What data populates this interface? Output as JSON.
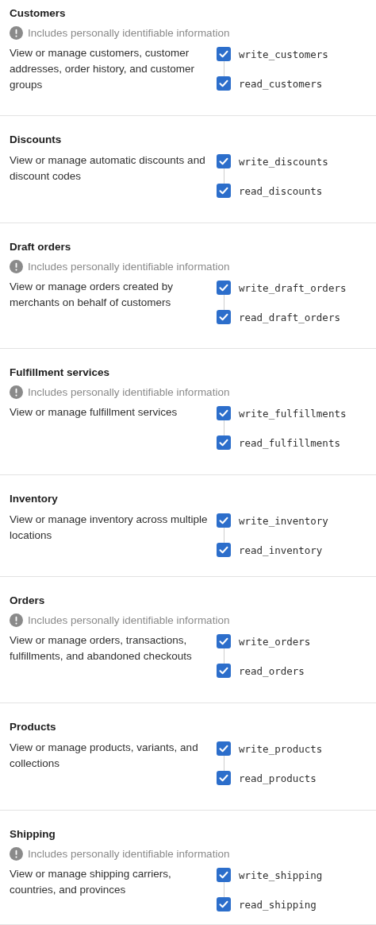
{
  "sections": [
    {
      "title": "Customers",
      "pii_note": "Includes personally identifiable information",
      "description": "View or manage customers, customer addresses, order history, and customer groups",
      "scopes": [
        {
          "label": "write_customers",
          "checked": true
        },
        {
          "label": "read_customers",
          "checked": true
        }
      ]
    },
    {
      "title": "Discounts",
      "description": "View or manage automatic discounts and discount codes",
      "scopes": [
        {
          "label": "write_discounts",
          "checked": true
        },
        {
          "label": "read_discounts",
          "checked": true
        }
      ]
    },
    {
      "title": "Draft orders",
      "pii_note": "Includes personally identifiable information",
      "description": "View or manage orders created by merchants on behalf of customers",
      "scopes": [
        {
          "label": "write_draft_orders",
          "checked": true
        },
        {
          "label": "read_draft_orders",
          "checked": true
        }
      ]
    },
    {
      "title": "Fulfillment services",
      "pii_note": "Includes personally identifiable information",
      "description": "View or manage fulfillment services",
      "scopes": [
        {
          "label": "write_fulfillments",
          "checked": true
        },
        {
          "label": "read_fulfillments",
          "checked": true
        }
      ]
    },
    {
      "title": "Inventory",
      "description": "View or manage inventory across multiple locations",
      "scopes": [
        {
          "label": "write_inventory",
          "checked": true
        },
        {
          "label": "read_inventory",
          "checked": true
        }
      ]
    },
    {
      "title": "Orders",
      "pii_note": "Includes personally identifiable information",
      "description": "View or manage orders, transactions, fulfillments, and abandoned checkouts",
      "scopes": [
        {
          "label": "write_orders",
          "checked": true
        },
        {
          "label": "read_orders",
          "checked": true
        }
      ]
    },
    {
      "title": "Products",
      "description": "View or manage products, variants, and collections",
      "scopes": [
        {
          "label": "write_products",
          "checked": true
        },
        {
          "label": "read_products",
          "checked": true
        }
      ]
    },
    {
      "title": "Shipping",
      "pii_note": "Includes personally identifiable information",
      "description": "View or manage shipping carriers, countries, and provinces",
      "scopes": [
        {
          "label": "write_shipping",
          "checked": true
        },
        {
          "label": "read_shipping",
          "checked": true
        }
      ]
    }
  ]
}
